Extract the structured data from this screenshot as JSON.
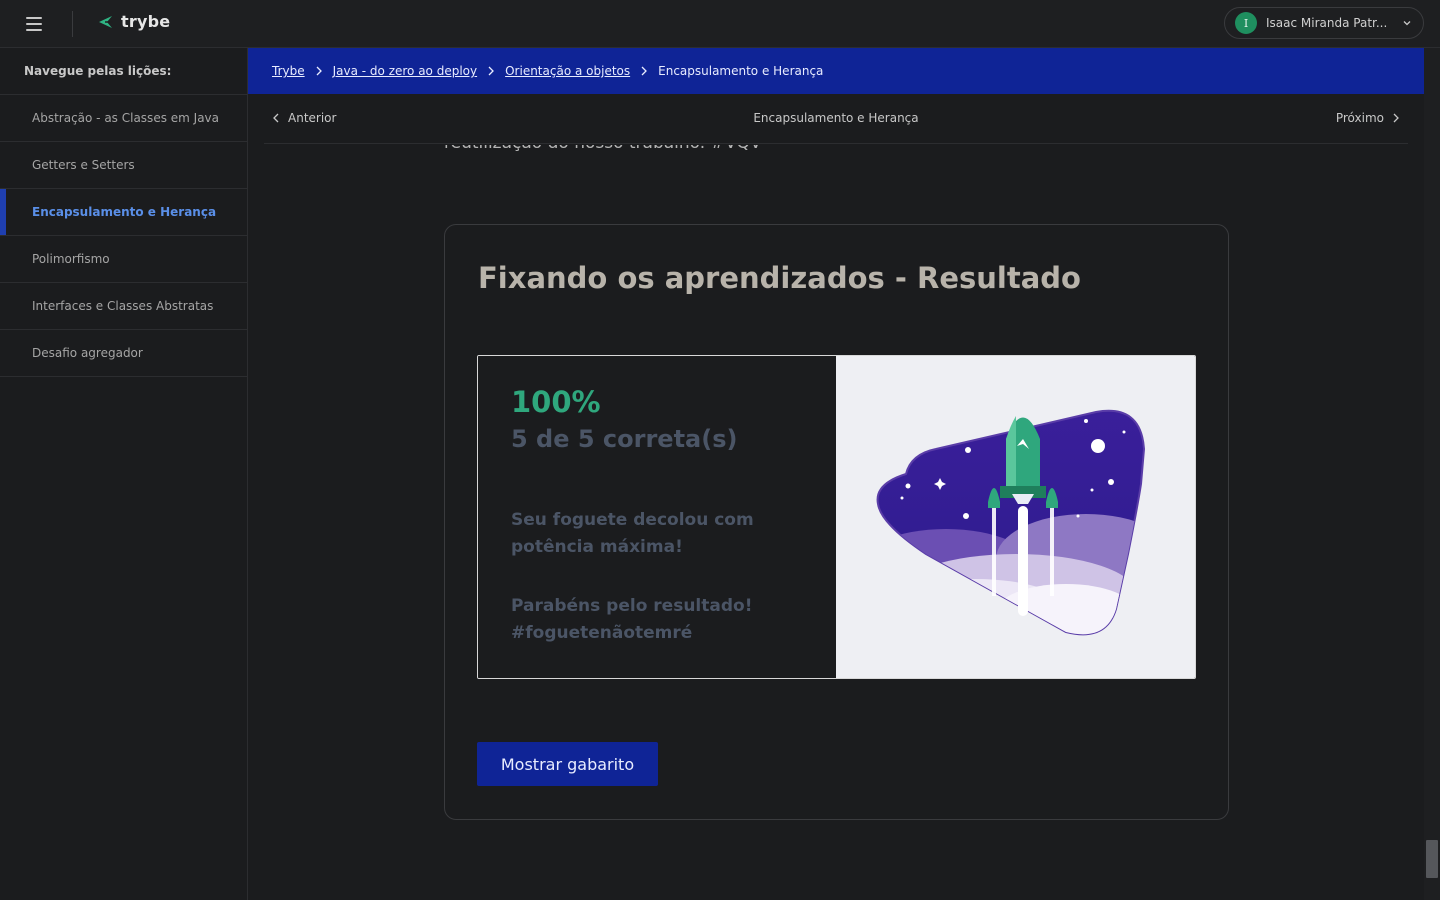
{
  "header": {
    "logo_text": "trybe",
    "user_initial": "I",
    "user_name": "Isaac Miranda Patr..."
  },
  "sidebar": {
    "title": "Navegue pelas lições:",
    "items": [
      {
        "label": "Abstração - as Classes em Java"
      },
      {
        "label": "Getters e Setters"
      },
      {
        "label": "Encapsulamento e Herança",
        "active": true
      },
      {
        "label": "Polimorfismo"
      },
      {
        "label": "Interfaces e Classes Abstratas"
      },
      {
        "label": "Desafio agregador"
      }
    ]
  },
  "breadcrumb": [
    {
      "label": "Trybe"
    },
    {
      "label": "Java - do zero ao deploy"
    },
    {
      "label": "Orientação a objetos"
    },
    {
      "label": "Encapsulamento e Herança"
    }
  ],
  "lesson_nav": {
    "prev_label": "Anterior",
    "title": "Encapsulamento e Herança",
    "next_label": "Próximo"
  },
  "content": {
    "previous_paragraph_tail": "reutilização do nosso trabalho. #VQV",
    "card_title": "Fixando os aprendizados - Resultado",
    "result": {
      "percent": "100%",
      "score": "5 de 5 correta(s)",
      "message_1": "Seu foguete decolou com potência máxima!",
      "message_2": "Parabéns pelo resultado! #foguetenãotemré"
    },
    "show_answers_label": "Mostrar gabarito"
  },
  "colors": {
    "brand_blue": "#0f2496",
    "success_green": "#2fa77d",
    "background": "#1b1c1e",
    "active_link": "#5a8fe8"
  },
  "icons": [
    "menu-icon",
    "trybe-logo-icon",
    "chevron-down-icon",
    "chevron-right-icon",
    "chevron-left-icon",
    "rocket-illustration"
  ]
}
